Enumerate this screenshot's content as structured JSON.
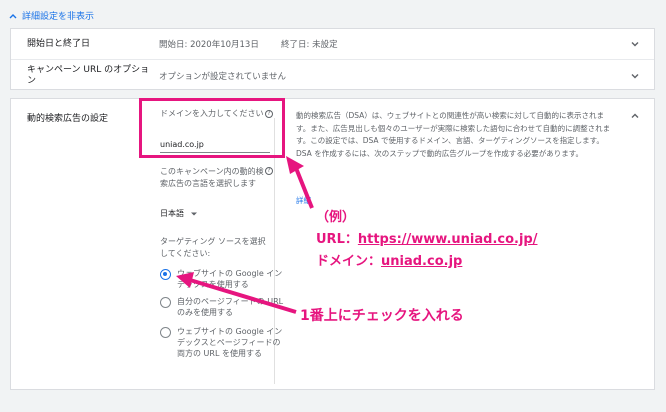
{
  "top": {
    "hide_label": "詳細設定を非表示"
  },
  "card1": {
    "row1": {
      "label": "開始日と終了日",
      "start": "開始日: 2020年10月13日",
      "end": "終了日: 未設定"
    },
    "row2": {
      "label": "キャンペーン URL のオプション",
      "value": "オプションが設定されていません"
    }
  },
  "dsa": {
    "label": "動的検索広告の設定",
    "domain_question": "ドメインを入力してください",
    "domain_value": "uniad.co.jp",
    "language_question": "このキャンペーン内の動的検索広告の言語を選択します",
    "language_value": "日本語",
    "targeting_question": "ターゲティング ソースを選択してください:",
    "options": [
      {
        "label": "ウェブサイトの Google インデックスを使用する",
        "selected": true
      },
      {
        "label": "自分のページフィードの URL のみを使用する",
        "selected": false
      },
      {
        "label": "ウェブサイトの Google インデックスとページフィードの両方の URL を使用する",
        "selected": false
      }
    ],
    "description": "動的検索広告（DSA）は、ウェブサイトとの関連性が高い検索に対して自動的に表示されます。また、広告見出しも個々のユーザーが実際に検索した語句に合わせて自動的に調整されます。この設定では、DSA で使用するドメイン、言語、ターゲティングソースを指定します。DSA を作成するには、次のステップで動的広告グループを作成する必要があります。",
    "detail_link": "詳細"
  },
  "annotations": {
    "example": "（例）",
    "url_prefix": "URL：",
    "url": "https://www.uniad.co.jp/",
    "domain_prefix": "ドメイン：",
    "domain": "uniad.co.jp",
    "check_note": "1番上にチェックを入れる"
  },
  "colors": {
    "accent": "#1a73e8",
    "annotation": "#e6157f"
  }
}
